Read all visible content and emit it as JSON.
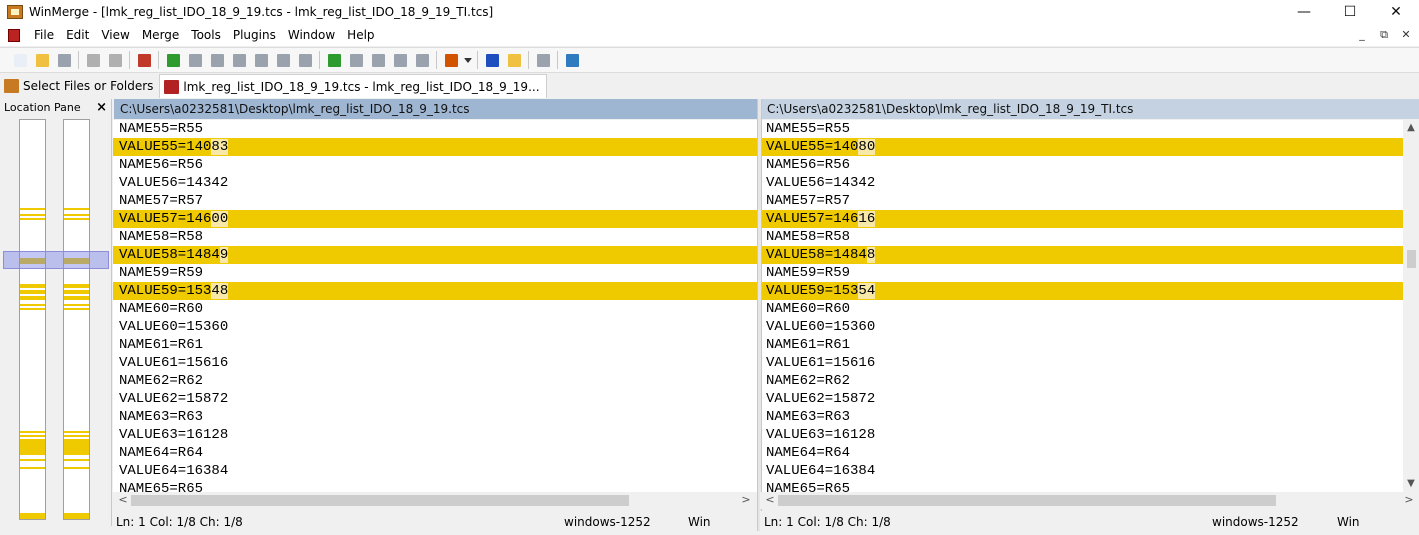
{
  "window": {
    "title": "WinMerge - [lmk_reg_list_IDO_18_9_19.tcs - lmk_reg_list_IDO_18_9_19_TI.tcs]",
    "minimize_glyph": "—",
    "maximize_glyph": "☐",
    "close_glyph": "✕"
  },
  "menu": {
    "items": [
      "File",
      "Edit",
      "View",
      "Merge",
      "Tools",
      "Plugins",
      "Window",
      "Help"
    ],
    "mdi_min": "_",
    "mdi_restore": "⧉",
    "mdi_close": "✕"
  },
  "toolbar": {
    "buttons": [
      {
        "icon": "new-document-icon",
        "color": "#e9eef7"
      },
      {
        "icon": "open-folder-icon",
        "color": "#f0c040"
      },
      {
        "icon": "save-icon",
        "color": "#9aa3ad"
      },
      {
        "icon": "undo-icon",
        "color": "#b0b0b0"
      },
      {
        "icon": "redo-icon",
        "color": "#b0b0b0"
      },
      {
        "icon": "diff-options-icon",
        "color": "#c0392b"
      },
      {
        "icon": "next-diff-icon",
        "color": "#2e9b2e"
      },
      {
        "icon": "prev-diff-icon",
        "color": "#9aa3ad"
      },
      {
        "icon": "first-diff-icon",
        "color": "#9aa3ad"
      },
      {
        "icon": "current-diff-icon",
        "color": "#9aa3ad"
      },
      {
        "icon": "last-diff-icon",
        "color": "#9aa3ad"
      },
      {
        "icon": "prev-conflict-icon",
        "color": "#9aa3ad"
      },
      {
        "icon": "next-conflict-icon",
        "color": "#9aa3ad"
      },
      {
        "icon": "all-diff-icon",
        "color": "#2e9b2e"
      },
      {
        "icon": "copy-right-icon",
        "color": "#9aa3ad"
      },
      {
        "icon": "copy-left-icon",
        "color": "#9aa3ad"
      },
      {
        "icon": "copy-right-advance-icon",
        "color": "#9aa3ad"
      },
      {
        "icon": "copy-left-advance-icon",
        "color": "#9aa3ad"
      },
      {
        "icon": "options-icon",
        "color": "#d35400"
      },
      {
        "icon": "dropdown-arrow-icon",
        "color": "#333333"
      },
      {
        "icon": "compare-right-icon",
        "color": "#1f4fbf"
      },
      {
        "icon": "compare-left-icon",
        "color": "#f0c040"
      },
      {
        "icon": "collapse-icon",
        "color": "#9aa3ad"
      },
      {
        "icon": "refresh-icon",
        "color": "#2e7bbf"
      }
    ]
  },
  "tabs": [
    {
      "label": "Select Files or Folders",
      "icon_color": "#c87a22"
    },
    {
      "label": "lmk_reg_list_IDO_18_9_19.tcs - lmk_reg_list_IDO_18_9_19...",
      "icon_color": "#b22222"
    }
  ],
  "location_pane": {
    "title": "Location Pane",
    "close_glyph": "×",
    "left_marks": [
      {
        "start": 0.22,
        "end": 0.225
      },
      {
        "start": 0.235,
        "end": 0.24
      },
      {
        "start": 0.245,
        "end": 0.25
      },
      {
        "start": 0.345,
        "end": 0.36
      },
      {
        "start": 0.41,
        "end": 0.42
      },
      {
        "start": 0.425,
        "end": 0.435
      },
      {
        "start": 0.44,
        "end": 0.45
      },
      {
        "start": 0.46,
        "end": 0.465
      },
      {
        "start": 0.47,
        "end": 0.475
      },
      {
        "start": 0.78,
        "end": 0.785
      },
      {
        "start": 0.79,
        "end": 0.795
      },
      {
        "start": 0.8,
        "end": 0.84
      },
      {
        "start": 0.85,
        "end": 0.855
      },
      {
        "start": 0.87,
        "end": 0.875
      },
      {
        "start": 0.985,
        "end": 1.0
      }
    ],
    "right_marks": [
      {
        "start": 0.22,
        "end": 0.225
      },
      {
        "start": 0.235,
        "end": 0.24
      },
      {
        "start": 0.245,
        "end": 0.25
      },
      {
        "start": 0.345,
        "end": 0.36
      },
      {
        "start": 0.41,
        "end": 0.42
      },
      {
        "start": 0.425,
        "end": 0.435
      },
      {
        "start": 0.44,
        "end": 0.45
      },
      {
        "start": 0.46,
        "end": 0.465
      },
      {
        "start": 0.47,
        "end": 0.475
      },
      {
        "start": 0.78,
        "end": 0.785
      },
      {
        "start": 0.79,
        "end": 0.795
      },
      {
        "start": 0.8,
        "end": 0.84
      },
      {
        "start": 0.85,
        "end": 0.855
      },
      {
        "start": 0.87,
        "end": 0.875
      },
      {
        "start": 0.985,
        "end": 1.0
      }
    ]
  },
  "left": {
    "path": "C:\\Users\\a0232581\\Desktop\\lmk_reg_list_IDO_18_9_19.tcs",
    "lines": [
      {
        "parts": [
          "NAME55=R55"
        ],
        "diff": false
      },
      {
        "parts": [
          "VALUE55=140",
          "83"
        ],
        "diff": true
      },
      {
        "parts": [
          "NAME56=R56"
        ],
        "diff": false
      },
      {
        "parts": [
          "VALUE56=14342"
        ],
        "diff": false
      },
      {
        "parts": [
          "NAME57=R57"
        ],
        "diff": false
      },
      {
        "parts": [
          "VALUE57=146",
          "00"
        ],
        "diff": true
      },
      {
        "parts": [
          "NAME58=R58"
        ],
        "diff": false
      },
      {
        "parts": [
          "VALUE58=1484",
          "9"
        ],
        "diff": true
      },
      {
        "parts": [
          "NAME59=R59"
        ],
        "diff": false
      },
      {
        "parts": [
          "VALUE59=153",
          "48"
        ],
        "diff": true
      },
      {
        "parts": [
          "NAME60=R60"
        ],
        "diff": false
      },
      {
        "parts": [
          "VALUE60=15360"
        ],
        "diff": false
      },
      {
        "parts": [
          "NAME61=R61"
        ],
        "diff": false
      },
      {
        "parts": [
          "VALUE61=15616"
        ],
        "diff": false
      },
      {
        "parts": [
          "NAME62=R62"
        ],
        "diff": false
      },
      {
        "parts": [
          "VALUE62=15872"
        ],
        "diff": false
      },
      {
        "parts": [
          "NAME63=R63"
        ],
        "diff": false
      },
      {
        "parts": [
          "VALUE63=16128"
        ],
        "diff": false
      },
      {
        "parts": [
          "NAME64=R64"
        ],
        "diff": false
      },
      {
        "parts": [
          "VALUE64=16384"
        ],
        "diff": false
      },
      {
        "parts": [
          "NAME65=R65"
        ],
        "diff": false
      }
    ],
    "status": {
      "pos": "Ln: 1  Col: 1/8  Ch: 1/8",
      "encoding": "windows-1252",
      "eol": "Win"
    }
  },
  "right": {
    "path": "C:\\Users\\a0232581\\Desktop\\lmk_reg_list_IDO_18_9_19_TI.tcs",
    "lines": [
      {
        "parts": [
          "NAME55=R55"
        ],
        "diff": false
      },
      {
        "parts": [
          "VALUE55=140",
          "80"
        ],
        "diff": true
      },
      {
        "parts": [
          "NAME56=R56"
        ],
        "diff": false
      },
      {
        "parts": [
          "VALUE56=14342"
        ],
        "diff": false
      },
      {
        "parts": [
          "NAME57=R57"
        ],
        "diff": false
      },
      {
        "parts": [
          "VALUE57=146",
          "16"
        ],
        "diff": true
      },
      {
        "parts": [
          "NAME58=R58"
        ],
        "diff": false
      },
      {
        "parts": [
          "VALUE58=1484",
          "8"
        ],
        "diff": true
      },
      {
        "parts": [
          "NAME59=R59"
        ],
        "diff": false
      },
      {
        "parts": [
          "VALUE59=153",
          "54"
        ],
        "diff": true
      },
      {
        "parts": [
          "NAME60=R60"
        ],
        "diff": false
      },
      {
        "parts": [
          "VALUE60=15360"
        ],
        "diff": false
      },
      {
        "parts": [
          "NAME61=R61"
        ],
        "diff": false
      },
      {
        "parts": [
          "VALUE61=15616"
        ],
        "diff": false
      },
      {
        "parts": [
          "NAME62=R62"
        ],
        "diff": false
      },
      {
        "parts": [
          "VALUE62=15872"
        ],
        "diff": false
      },
      {
        "parts": [
          "NAME63=R63"
        ],
        "diff": false
      },
      {
        "parts": [
          "VALUE63=16128"
        ],
        "diff": false
      },
      {
        "parts": [
          "NAME64=R64"
        ],
        "diff": false
      },
      {
        "parts": [
          "VALUE64=16384"
        ],
        "diff": false
      },
      {
        "parts": [
          "NAME65=R65"
        ],
        "diff": false
      }
    ],
    "status": {
      "pos": "Ln: 1  Col: 1/8  Ch: 1/8",
      "encoding": "windows-1252",
      "eol": "Win"
    }
  },
  "scroll": {
    "left_arrow": "<",
    "right_arrow": ">",
    "up_arrow": "▲",
    "down_arrow": "▼"
  },
  "colors": {
    "diff": "#efca00",
    "diff_word": "#f7e8a8",
    "left_header": "#9fb6d2",
    "right_header": "#c4d2e2"
  }
}
